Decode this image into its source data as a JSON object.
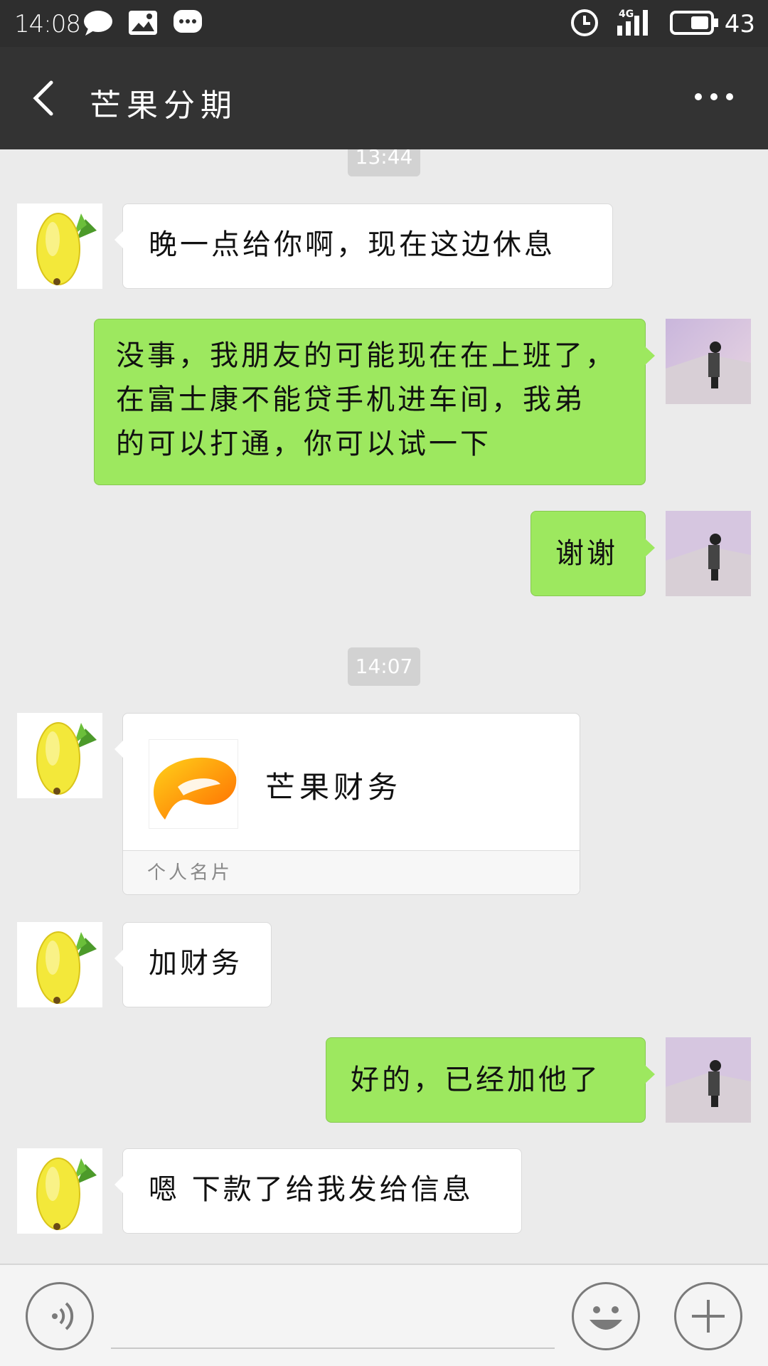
{
  "status_bar": {
    "time": "14:08",
    "network": "4G",
    "battery": "43",
    "icons": [
      "chat-bubble-icon",
      "image-icon",
      "message-icon",
      "alarm-icon",
      "signal-icon",
      "battery-icon"
    ]
  },
  "header": {
    "title": "芒果分期",
    "back_icon": "chevron-left-icon",
    "more_icon": "ellipsis-icon"
  },
  "chat": {
    "timestamps": [
      "13:44",
      "14:07"
    ],
    "messages": [
      {
        "from": "contact",
        "text": "晚一点给你啊，现在这边休息"
      },
      {
        "from": "me",
        "lines": [
          "没事，我朋友的可能现在在上班了，",
          "在富士康不能贷手机进车间，我弟",
          "的可以打通，你可以试一下"
        ]
      },
      {
        "from": "me",
        "text": "谢谢"
      },
      {
        "from": "contact",
        "card": {
          "name": "芒果财务",
          "footer": "个人名片"
        }
      },
      {
        "from": "contact",
        "text": "加财务"
      },
      {
        "from": "me",
        "text": "好的，已经加他了"
      },
      {
        "from": "contact",
        "text": "嗯 下款了给我发给信息"
      }
    ]
  },
  "input_bar": {
    "voice_icon": "voice-icon",
    "emoji_icon": "emoji-icon",
    "plus_icon": "plus-icon"
  },
  "colors": {
    "header_bg": "#333333",
    "chat_bg": "#ebebeb",
    "outgoing_bubble": "#9de85f",
    "incoming_bubble": "#ffffff"
  }
}
